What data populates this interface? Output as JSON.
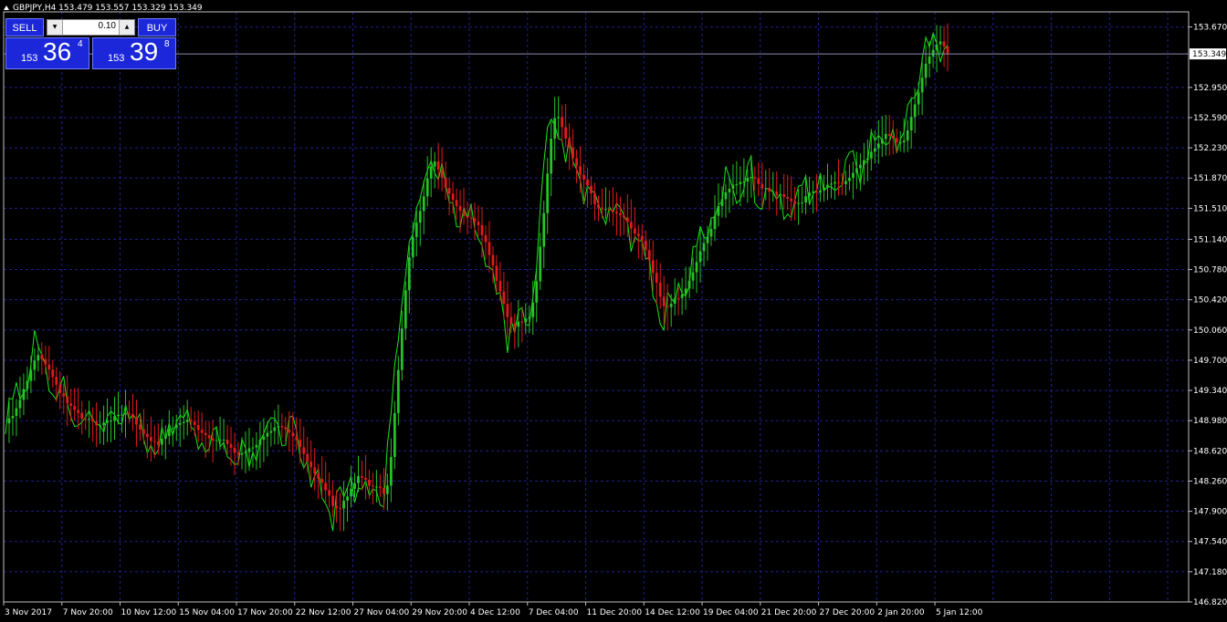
{
  "window": {
    "header": "GBPJPY,H4  153.479 153.557 153.329 153.349"
  },
  "one_click": {
    "sell_label": "SELL",
    "buy_label": "BUY",
    "lot": "0.10",
    "sell_prefix": "153",
    "sell_big": "36",
    "sell_sup": "4",
    "buy_prefix": "153",
    "buy_big": "39",
    "buy_sup": "8"
  },
  "colors": {
    "background": "#000000",
    "grid": "#20208a",
    "bull": "#27c227",
    "bear": "#e01b1b",
    "line": "#17e817",
    "bid_line": "#8a8ab0",
    "axis": "#c0c0c0"
  },
  "chart_data": {
    "type": "candlestick",
    "symbol": "GBPJPY",
    "timeframe": "H4",
    "ylim": [
      146.82,
      153.85
    ],
    "y_ticks": [
      "153.670",
      "152.950",
      "152.590",
      "152.230",
      "151.870",
      "151.510",
      "151.140",
      "150.780",
      "150.420",
      "150.060",
      "149.700",
      "149.340",
      "148.980",
      "148.620",
      "148.260",
      "147.900",
      "147.540",
      "147.180",
      "146.820"
    ],
    "current_price_label": "153.349",
    "current_price": 153.349,
    "x_labels": [
      "3 Nov 2017",
      "7 Nov 20:00",
      "10 Nov 12:00",
      "15 Nov 04:00",
      "17 Nov 20:00",
      "22 Nov 12:00",
      "27 Nov 04:00",
      "29 Nov 20:00",
      "4 Dec 12:00",
      "7 Dec 04:00",
      "11 Dec 20:00",
      "14 Dec 12:00",
      "19 Dec 04:00",
      "21 Dec 20:00",
      "27 Dec 20:00",
      "2 Jan 20:00",
      "5 Jan 12:00"
    ],
    "x_label_bars": [
      0,
      16,
      32,
      48,
      64,
      80,
      96,
      112,
      128,
      144,
      160,
      176,
      192,
      208,
      224,
      240,
      256
    ],
    "grid": true,
    "bar_count": 260,
    "close_path": [
      [
        0,
        148.95
      ],
      [
        8,
        149.8
      ],
      [
        16,
        149.2
      ],
      [
        24,
        148.9
      ],
      [
        32,
        149.1
      ],
      [
        40,
        148.7
      ],
      [
        48,
        149.0
      ],
      [
        56,
        148.8
      ],
      [
        64,
        148.55
      ],
      [
        72,
        148.9
      ],
      [
        80,
        148.7
      ],
      [
        90,
        147.9
      ],
      [
        96,
        148.3
      ],
      [
        104,
        148.1
      ],
      [
        110,
        151.0
      ],
      [
        116,
        152.1
      ],
      [
        124,
        151.5
      ],
      [
        130,
        151.3
      ],
      [
        138,
        150.1
      ],
      [
        144,
        150.2
      ],
      [
        150,
        152.8
      ],
      [
        156,
        152.0
      ],
      [
        162,
        151.5
      ],
      [
        168,
        151.4
      ],
      [
        174,
        151.1
      ],
      [
        180,
        150.3
      ],
      [
        186,
        150.5
      ],
      [
        192,
        151.2
      ],
      [
        198,
        151.8
      ],
      [
        204,
        151.9
      ],
      [
        210,
        151.7
      ],
      [
        216,
        151.55
      ],
      [
        224,
        151.8
      ],
      [
        232,
        151.9
      ],
      [
        240,
        152.4
      ],
      [
        246,
        152.3
      ],
      [
        252,
        153.2
      ],
      [
        256,
        153.5
      ],
      [
        259,
        153.349
      ]
    ],
    "legend": "none"
  }
}
